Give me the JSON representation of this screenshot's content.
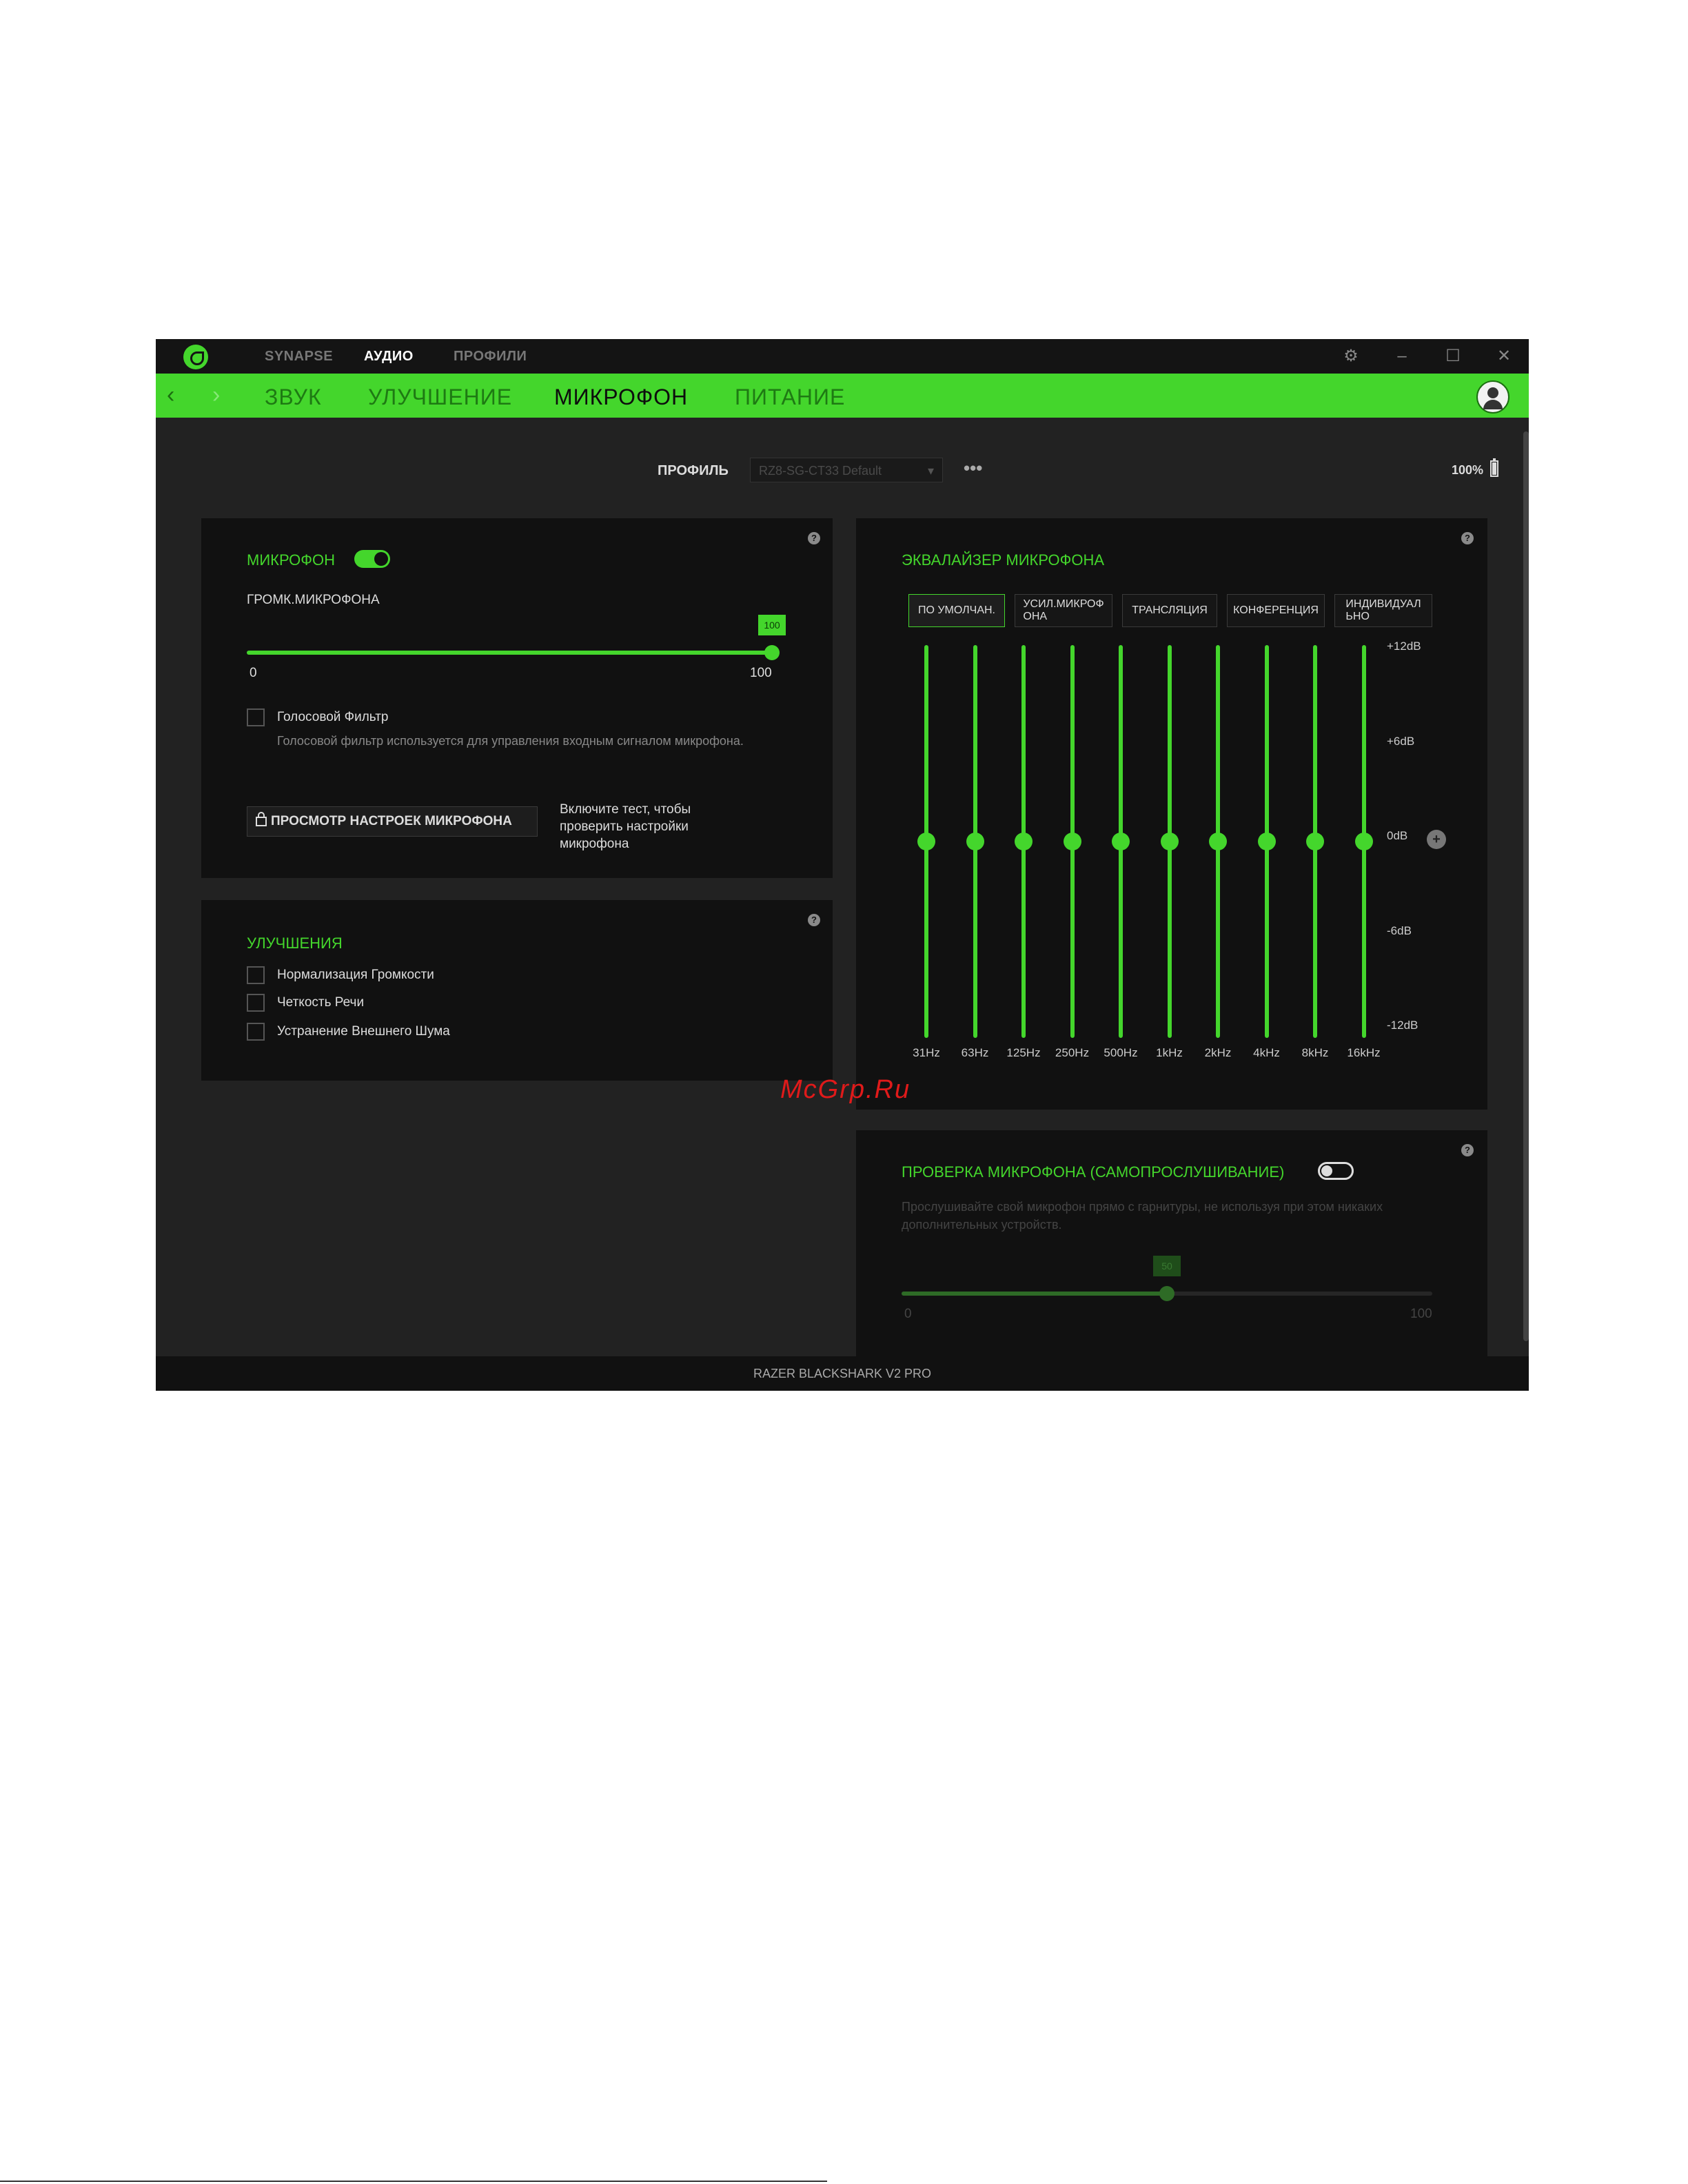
{
  "titlebar": {
    "nav": [
      "SYNAPSE",
      "АУДИО",
      "ПРОФИЛИ"
    ],
    "active_nav": 1,
    "controls": [
      "gear-icon",
      "minimize-icon",
      "maximize-icon",
      "close-icon"
    ]
  },
  "subnav": {
    "tabs": [
      "ЗВУК",
      "УЛУЧШЕНИЕ",
      "МИКРОФОН",
      "ПИТАНИЕ"
    ],
    "active_tab": 2
  },
  "profile": {
    "label": "ПРОФИЛЬ",
    "value": "RZ8-SG-CT33 Default",
    "more": "•••",
    "battery": "100%"
  },
  "mic_panel": {
    "title": "МИКРОФОН",
    "toggle_on": true,
    "volume_label": "ГРОМК.МИКРОФОНА",
    "volume_value": 100,
    "volume_bubble": "100",
    "min_label": "0",
    "max_label": "100",
    "voice_filter_label": "Голосовой Фильтр",
    "voice_filter_checked": false,
    "voice_filter_desc": "Голосовой фильтр используется для управления входным сигналом микрофона.",
    "view_button": "ПРОСМОТР НАСТРОЕК МИКРОФОНА",
    "test_hint": "Включите тест, чтобы проверить настройки микрофона"
  },
  "enhance_panel": {
    "title": "УЛУЧШЕНИЯ",
    "items": [
      {
        "label": "Нормализация Громкости",
        "checked": false
      },
      {
        "label": "Четкость Речи",
        "checked": false
      },
      {
        "label": "Устранение Внешнего Шума",
        "checked": false
      }
    ]
  },
  "eq_panel": {
    "title": "ЭКВАЛАЙЗЕР МИКРОФОНА",
    "presets": [
      "ПО УМОЛЧАН.",
      "УСИЛ.МИКРОФ\nОНА",
      "ТРАНСЛЯЦИЯ",
      "КОНФЕРЕНЦИЯ",
      "ИНДИВИДУАЛ\nЬНО"
    ],
    "active_preset": 0,
    "db_labels": [
      "+12dB",
      "+6dB",
      "0dB",
      "-6dB",
      "-12dB"
    ],
    "bands": [
      {
        "freq": "31Hz",
        "gain": 0
      },
      {
        "freq": "63Hz",
        "gain": 0
      },
      {
        "freq": "125Hz",
        "gain": 0
      },
      {
        "freq": "250Hz",
        "gain": 0
      },
      {
        "freq": "500Hz",
        "gain": 0
      },
      {
        "freq": "1kHz",
        "gain": 0
      },
      {
        "freq": "2kHz",
        "gain": 0
      },
      {
        "freq": "4kHz",
        "gain": 0
      },
      {
        "freq": "8kHz",
        "gain": 0
      },
      {
        "freq": "16kHz",
        "gain": 0
      }
    ],
    "range_db": [
      -12,
      12
    ]
  },
  "sidetone_panel": {
    "title": "ПРОВЕРКА МИКРОФОНА (САМОПРОСЛУШИВАНИЕ)",
    "toggle_on": false,
    "desc": "Прослушивайте свой микрофон прямо с гарнитуры, не используя при этом никаких дополнительных устройств.",
    "value": 50,
    "bubble": "50",
    "min_label": "0",
    "max_label": "100"
  },
  "footer": {
    "device": "RAZER BLACKSHARK V2 PRO"
  },
  "watermark": "McGrp.Ru",
  "colors": {
    "accent": "#44d62c",
    "panel": "#111111",
    "background": "#222222"
  }
}
